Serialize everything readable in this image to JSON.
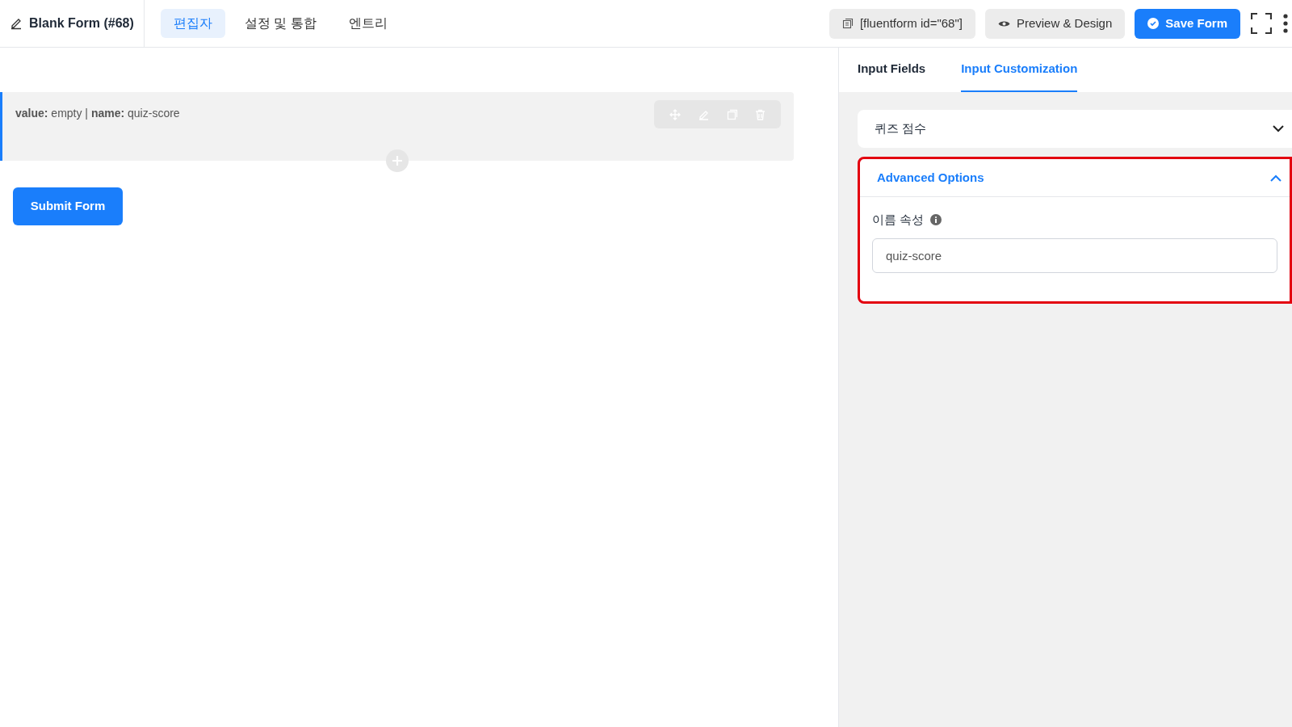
{
  "header": {
    "form_title": "Blank Form (#68)",
    "nav_tabs": [
      {
        "label": "편집자",
        "selected": true
      },
      {
        "label": "설정 및 통합",
        "selected": false
      },
      {
        "label": "엔트리",
        "selected": false
      }
    ],
    "shortcode": "[fluentform id=\"68\"]",
    "preview_button": "Preview & Design",
    "save_button": "Save Form"
  },
  "canvas": {
    "field_summary": "**value:** empty | **name:** quiz-score",
    "submit_button": "Submit Form"
  },
  "sidebar": {
    "tabs": [
      {
        "label": "Input Fields",
        "selected": false
      },
      {
        "label": "Input Customization",
        "selected": true
      }
    ],
    "sections": [
      {
        "title": "퀴즈 점수",
        "expanded": false,
        "highlighted": false
      },
      {
        "title": "Advanced Options",
        "expanded": true,
        "highlighted": true,
        "field": {
          "label": "이름 속성",
          "value": "quiz-score"
        }
      }
    ]
  }
}
